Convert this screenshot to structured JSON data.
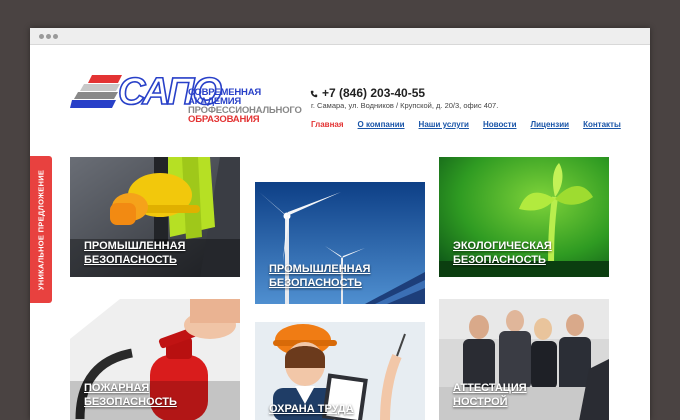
{
  "logo": {
    "abbr": "САПО",
    "line1": "СОВРЕМЕННАЯ",
    "line2": "АКАДЕМИЯ",
    "line3": "ПРОФЕССИОНАЛЬНОГО",
    "line4": "ОБРАЗОВАНИЯ",
    "colors": {
      "blue": "#2840c8",
      "red": "#e33333",
      "gray": "#888888"
    }
  },
  "contacts": {
    "phone": "+7 (846) 203-40-55",
    "address": "г. Самара, ул. Водников / Крупской, д. 20/3, офис 407."
  },
  "nav": {
    "items": [
      {
        "label": "Главная",
        "active": true
      },
      {
        "label": "О компании",
        "active": false
      },
      {
        "label": "Наши услуги",
        "active": false
      },
      {
        "label": "Новости",
        "active": false
      },
      {
        "label": "Лицензии",
        "active": false
      },
      {
        "label": "Контакты",
        "active": false
      }
    ]
  },
  "side_tab": {
    "label": "УНИКАЛЬНОЕ ПРЕДЛОЖЕНИЕ",
    "color": "#e8413f"
  },
  "tiles": [
    {
      "line1": "ПРОМЫШЛЕННАЯ",
      "line2": "БЕЗОПАСНОСТЬ",
      "icon": "hard-hat-worker"
    },
    {
      "line1": "ПРОМЫШЛЕННАЯ",
      "line2": "БЕЗОПАСНОСТЬ",
      "icon": "wind-turbine"
    },
    {
      "line1": "ЭКОЛОГИЧЕСКАЯ",
      "line2": "БЕЗОПАСНОСТЬ",
      "icon": "sprout"
    },
    {
      "line1": "ПОЖАРНАЯ",
      "line2": "БЕЗОПАСНОСТЬ",
      "icon": "fire-extinguisher"
    },
    {
      "line1": "ОХРАНА ТРУДА",
      "line2": "",
      "icon": "worker-with-clipboard"
    },
    {
      "line1": "АТТЕСТАЦИЯ",
      "line2": "НОСТРОЙ",
      "icon": "business-meeting"
    }
  ]
}
